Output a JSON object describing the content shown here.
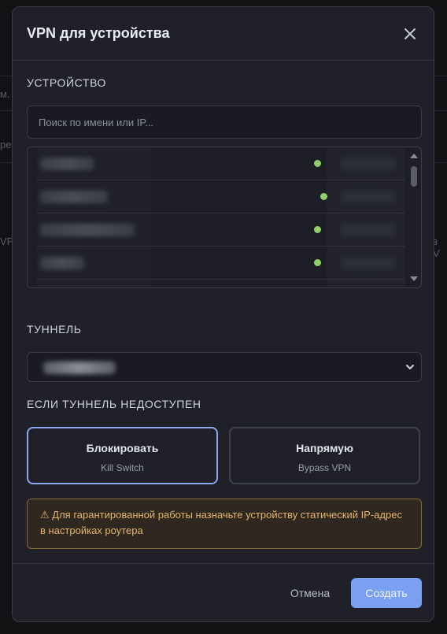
{
  "background": {
    "fragments": [
      "м.",
      "ре",
      "VP",
      "з V"
    ]
  },
  "modal": {
    "title": "VPN для устройства",
    "close_icon": "close-icon"
  },
  "device_section": {
    "label": "УСТРОЙСТВО",
    "search_placeholder": "Поиск по имени или IP...",
    "devices": [
      {
        "name": "",
        "ip": "",
        "status": "online"
      },
      {
        "name": "",
        "ip": "",
        "status": "online"
      },
      {
        "name": "",
        "ip": "",
        "status": "online"
      },
      {
        "name": "",
        "ip": "",
        "status": "online"
      }
    ]
  },
  "tunnel_section": {
    "label": "ТУННЕЛЬ",
    "selected_value": ""
  },
  "fallback_section": {
    "label": "ЕСЛИ ТУННЕЛЬ НЕДОСТУПЕН",
    "options": [
      {
        "title": "Блокировать",
        "subtitle": "Kill Switch",
        "selected": true
      },
      {
        "title": "Напрямую",
        "subtitle": "Bypass VPN",
        "selected": false
      }
    ]
  },
  "warning": {
    "icon": "warning-icon",
    "text": "Для гарантированной работы назначьте устройству статический IP-адрес в настройках роутера"
  },
  "footer": {
    "cancel_label": "Отмена",
    "create_label": "Создать"
  },
  "colors": {
    "accent": "#7aa0f2",
    "online": "#8fd06a",
    "warning": "#e6b56a"
  }
}
